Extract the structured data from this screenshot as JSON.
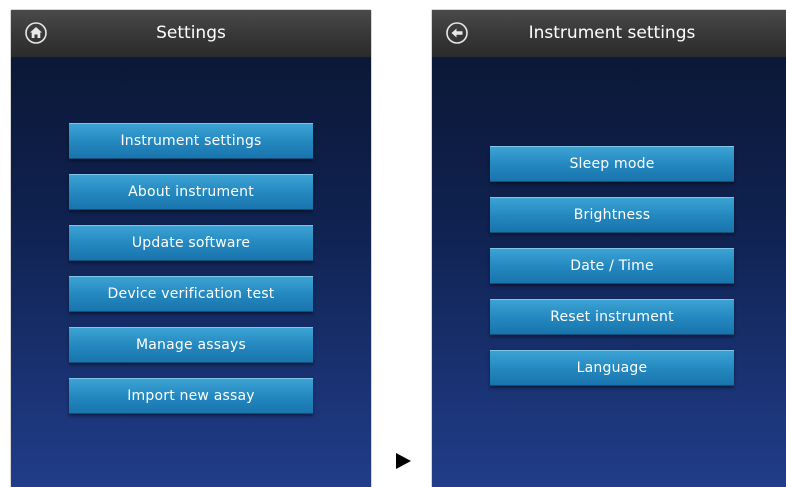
{
  "left_screen": {
    "title": "Settings",
    "header_icon": "home-icon",
    "buttons": [
      "Instrument settings",
      "About instrument",
      "Update software",
      "Device verification test",
      "Manage assays",
      "Import new assay"
    ]
  },
  "right_screen": {
    "title": "Instrument settings",
    "header_icon": "back-arrow-icon",
    "buttons": [
      "Sleep mode",
      "Brightness",
      "Date / Time",
      "Reset instrument",
      "Language"
    ]
  },
  "transition_arrow": "play-arrow-icon"
}
